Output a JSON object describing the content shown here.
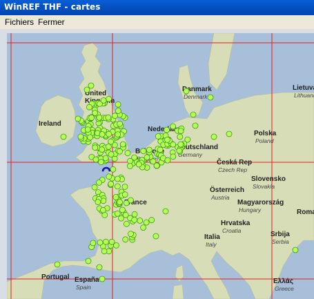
{
  "window": {
    "title": "WinREF THF - cartes"
  },
  "menu": {
    "items": [
      "Fichiers",
      "Fermer"
    ]
  },
  "map": {
    "labels": [
      {
        "name": "United Kingdom",
        "main": "United\nKingdom",
        "sub": ""
      },
      {
        "name": "Ireland",
        "main": "Ireland",
        "sub": ""
      },
      {
        "name": "Danmark",
        "main": "Danmark",
        "sub": "Denmark"
      },
      {
        "name": "Lietuva",
        "main": "Lietuva",
        "sub": "Lithuania"
      },
      {
        "name": "Nederland",
        "main": "Nederland",
        "sub": ""
      },
      {
        "name": "Polska",
        "main": "Polska",
        "sub": "Poland"
      },
      {
        "name": "Belgique",
        "main": "Belgique",
        "sub": "Belgium"
      },
      {
        "name": "Deutschland",
        "main": "Deutschland",
        "sub": "Germany"
      },
      {
        "name": "Česká Rep",
        "main": "Česká Rep",
        "sub": "Czech Rep"
      },
      {
        "name": "Slovensko",
        "main": "Slovensko",
        "sub": "Slovakia"
      },
      {
        "name": "France",
        "main": "France",
        "sub": ""
      },
      {
        "name": "Österreich",
        "main": "Österreich",
        "sub": "Austria"
      },
      {
        "name": "Magyarország",
        "main": "Magyarország",
        "sub": "Hungary"
      },
      {
        "name": "Roma",
        "main": "Roma",
        "sub": ""
      },
      {
        "name": "Hrvatska",
        "main": "Hrvatska",
        "sub": "Croatia"
      },
      {
        "name": "Srbija",
        "main": "Srbija",
        "sub": "Serbia"
      },
      {
        "name": "Italia",
        "main": "Italia",
        "sub": "Italy"
      },
      {
        "name": "Portugal",
        "main": "Portugal",
        "sub": ""
      },
      {
        "name": "España",
        "main": "España",
        "sub": "Spain"
      },
      {
        "name": "Ελλάς",
        "main": "Ελλάς",
        "sub": "Greece"
      }
    ],
    "colors": {
      "sea": "#a7bfd9",
      "land": "#d7ddb6",
      "grid": "#e02020",
      "marker_fill": "#b6ff58",
      "marker_stroke": "#3a9a12",
      "selected_marker": "#1020c8"
    }
  }
}
